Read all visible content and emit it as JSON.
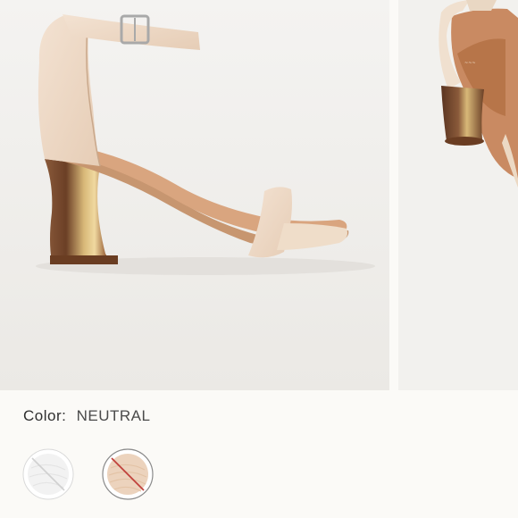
{
  "product": {
    "color_label": "Color:",
    "color_value": "NEUTRAL"
  },
  "gallery": {
    "images": [
      {
        "icon": "sandal-side-view-image"
      },
      {
        "icon": "sandal-angle-view-image"
      }
    ]
  },
  "swatches": [
    {
      "name": "white",
      "color": "#f4f4f4",
      "unavailable": true,
      "selected": false
    },
    {
      "name": "neutral",
      "color": "#ecd3bd",
      "unavailable": true,
      "selected": true
    }
  ],
  "colors": {
    "unavailable_slash": "#c0413b",
    "text": "#2f2f2f"
  }
}
